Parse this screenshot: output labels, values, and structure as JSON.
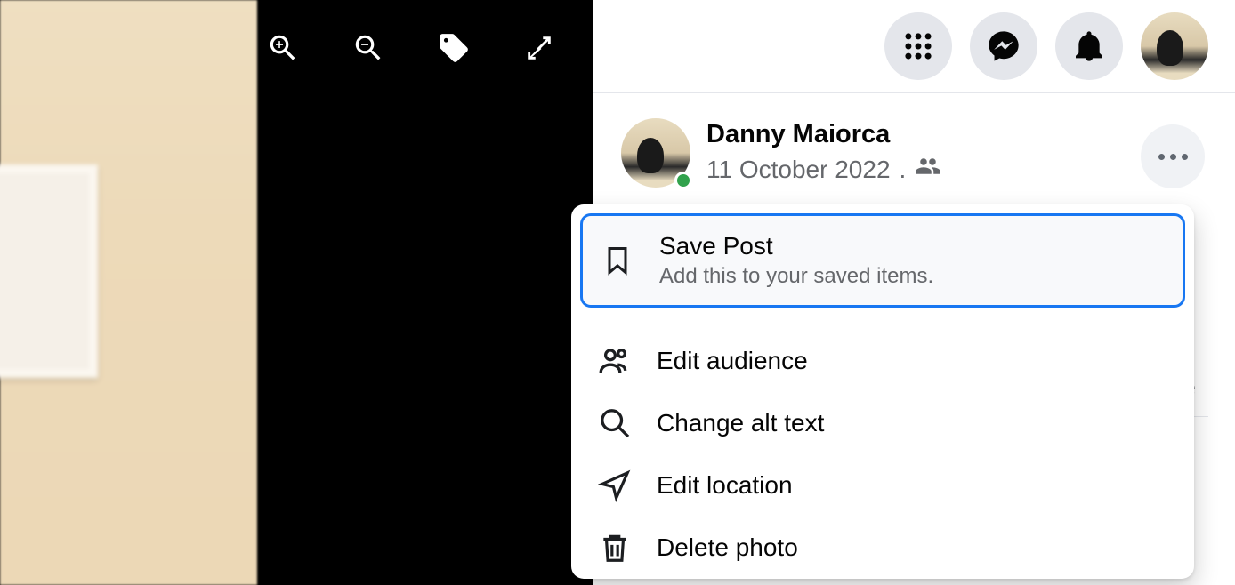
{
  "post": {
    "author_name": "Danny Maiorca",
    "date": "11 October 2022",
    "separator": " . ",
    "audience_icon": "friends-icon",
    "online": true
  },
  "menu": {
    "save": {
      "title": "Save Post",
      "subtitle": "Add this to your saved items."
    },
    "edit_audience": {
      "title": "Edit audience"
    },
    "change_alt": {
      "title": "Change alt text"
    },
    "edit_location": {
      "title": "Edit location"
    },
    "delete_photo": {
      "title": "Delete photo"
    }
  },
  "peek_text": "e",
  "header": {
    "buttons": [
      "menu",
      "messenger",
      "notifications",
      "account"
    ]
  },
  "photo_toolbar": [
    "zoom-in",
    "zoom-out",
    "tag",
    "fullscreen"
  ]
}
